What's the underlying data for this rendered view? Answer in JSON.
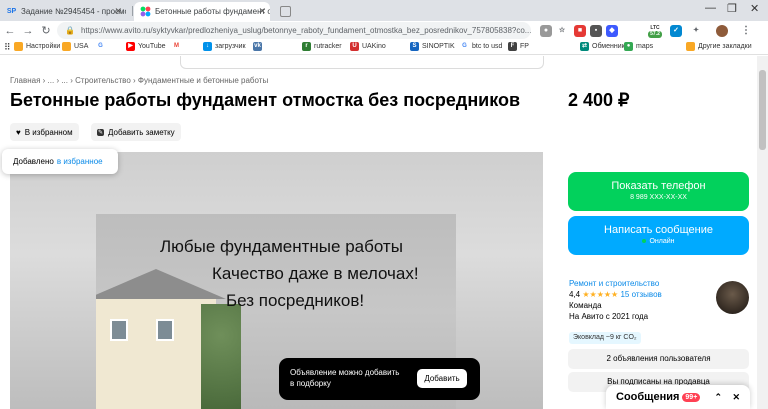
{
  "browser": {
    "tabs": [
      {
        "label": "Задание №2945454 - просмотр з",
        "favicon": "SP"
      },
      {
        "label": "Бетонные работы фундамент отм",
        "favicon": ""
      }
    ],
    "new_tab": "+",
    "url": "https://www.avito.ru/syktyvkar/predlozheniya_uslug/betonnye_raboty_fundament_otmostka_bez_posrednikov_757805838?co...",
    "bookmarks": [
      "Настройки",
      "USA",
      "YouTube",
      "загрузчик",
      "rutracker",
      "UAKino",
      "SINOPTIK",
      "btc to usd",
      "FP",
      "Обменник",
      "maps",
      "Другие закладки"
    ],
    "ext_badges": [
      "LTC",
      "57.2"
    ]
  },
  "page": {
    "breadcrumbs": "Главная › ... › ... › Строительство › Фундаментные и бетонные работы",
    "title": "Бетонные работы фундамент отмостка без посредников",
    "price": "2 400 ₽",
    "favorite_button": "В избранном",
    "note_button": "Добавить заметку",
    "tooltip_text": "Добавлено",
    "tooltip_link": "в избранное",
    "photo_lines": [
      "Любые фундаментные работы",
      "Качество даже в мелочах!",
      "Без посредников!"
    ],
    "toast_text": "Объявление можно добавить в подборку",
    "toast_button": "Добавить",
    "show_phone": "Показать телефон",
    "phone_masked": "8 989 XXX-XX-XX",
    "write_message": "Написать сообщение",
    "online": "Онлайн",
    "seller_name": "Ремонт и строительство",
    "rating": "4,4",
    "stars": "★★★★★",
    "reviews": "15 отзывов",
    "seller_type": "Команда",
    "on_avito": "На Авито с 2021 года",
    "eco": "Эковклад ~9 кг CO₂",
    "user_ads": "2 объявления пользователя",
    "subscribed": "Вы подписаны на продавца",
    "messages": "Сообщения",
    "messages_badge": "99+"
  },
  "colors": {
    "green": "#02d15c",
    "blue": "#00aaff",
    "link": "#0a8ae8"
  }
}
